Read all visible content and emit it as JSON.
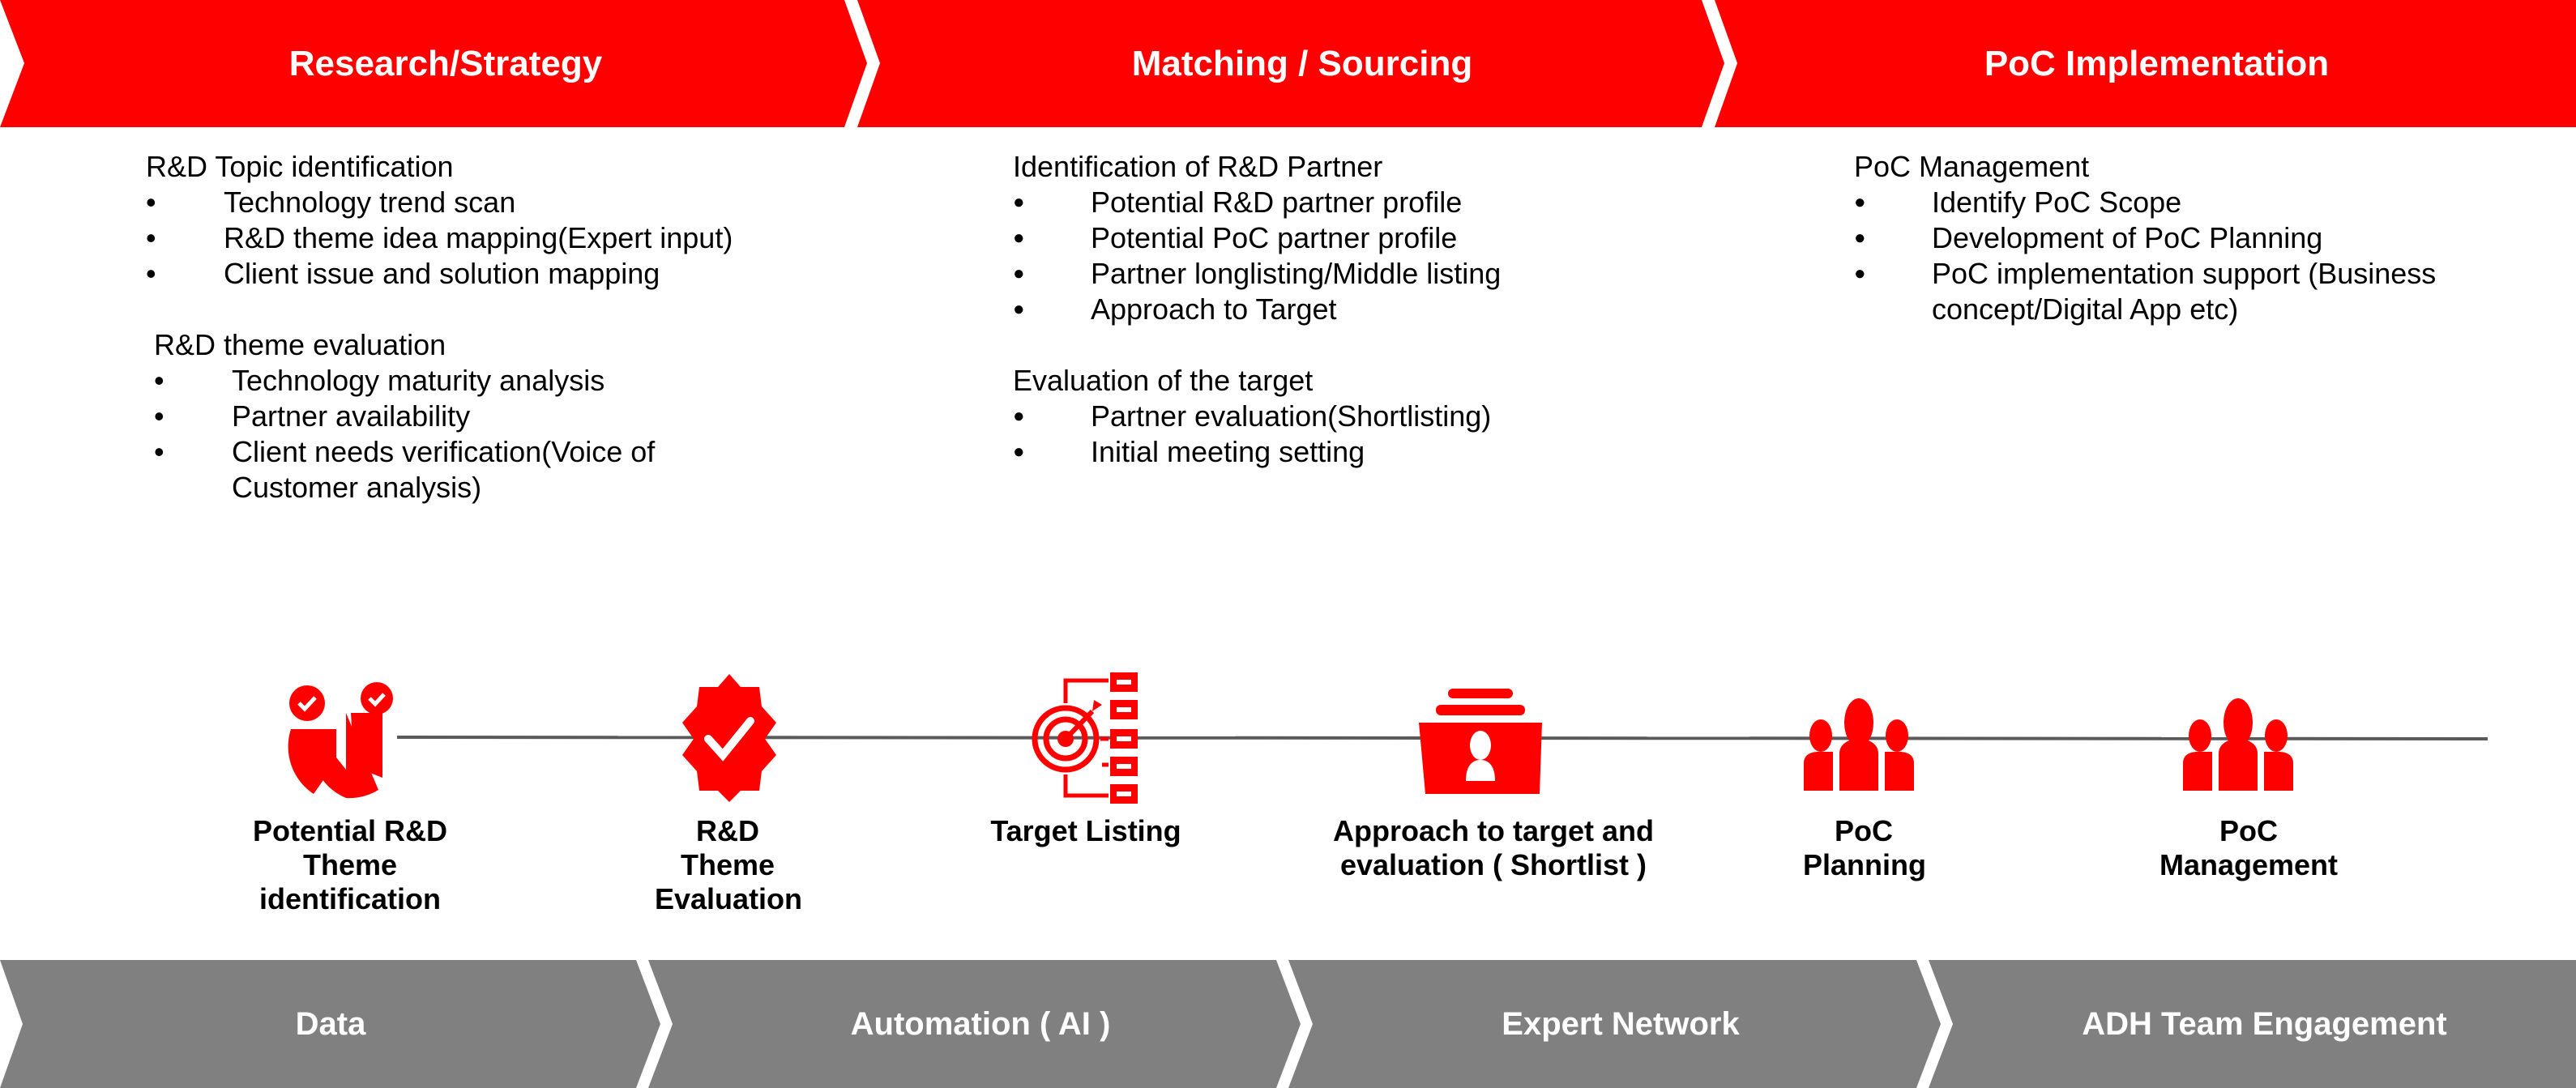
{
  "phases": [
    {
      "title": "Research/Strategy"
    },
    {
      "title": "Matching / Sourcing"
    },
    {
      "title": "PoC Implementation"
    }
  ],
  "columns": [
    {
      "sections": [
        {
          "heading": "R&D Topic identification",
          "bullet": "•",
          "items": [
            "Technology trend scan",
            "R&D theme idea mapping(Expert input)",
            "Client issue and solution mapping"
          ]
        },
        {
          "heading": "R&D theme evaluation",
          "bullet": "•",
          "items": [
            "Technology maturity analysis",
            "Partner availability",
            "Client needs verification(Voice of Customer analysis)"
          ]
        }
      ]
    },
    {
      "sections": [
        {
          "heading": "Identification of R&D Partner",
          "bullet": "●",
          "items": [
            "Potential R&D partner profile",
            "Potential PoC partner profile",
            "Partner longlisting/Middle listing",
            "Approach to Target"
          ]
        },
        {
          "heading": "Evaluation of the target",
          "bullet": "●",
          "items": [
            "Partner evaluation(Shortlisting)",
            "Initial meeting setting"
          ]
        }
      ]
    },
    {
      "sections": [
        {
          "heading": "PoC Management",
          "bullet": "●",
          "items": [
            "Identify PoC Scope",
            "Development of PoC Planning",
            "PoC implementation support (Business concept/Digital App etc)"
          ]
        }
      ]
    }
  ],
  "steps": [
    {
      "label": "Potential R&D Theme identification",
      "icon": "pie-chart-check-icon"
    },
    {
      "label": "R&D Theme Evaluation",
      "icon": "badge-check-icon"
    },
    {
      "label": "Target Listing",
      "icon": "target-list-icon"
    },
    {
      "label": "Approach to target and evaluation ( Shortlist )",
      "icon": "profile-folder-icon"
    },
    {
      "label": "PoC Planning",
      "icon": "team-icon"
    },
    {
      "label": "PoC Management",
      "icon": "team-icon"
    }
  ],
  "enablers": [
    {
      "title": "Data"
    },
    {
      "title": "Automation ( AI )"
    },
    {
      "title": "Expert Network"
    },
    {
      "title": "ADH Team Engagement"
    }
  ],
  "colors": {
    "primary": "#ff0000",
    "secondary": "#808080",
    "connector": "#5a5a5a"
  }
}
